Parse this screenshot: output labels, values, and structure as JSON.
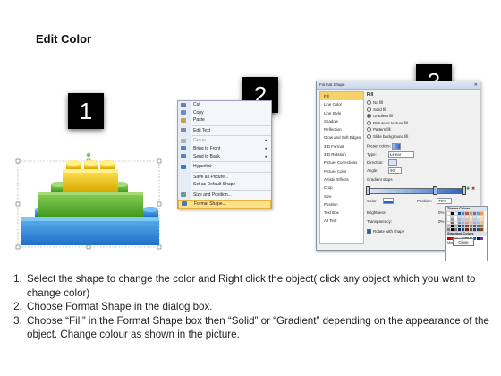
{
  "title": "Edit Color",
  "steps": {
    "one": "1",
    "two": "2",
    "three": "3"
  },
  "context_menu": {
    "items": [
      {
        "label": "Cut",
        "icon": "scissors-icon",
        "state": "normal",
        "color": "#6a7fa0"
      },
      {
        "label": "Copy",
        "icon": "copy-icon",
        "state": "normal",
        "color": "#6a8cc0"
      },
      {
        "label": "Paste",
        "icon": "paste-icon",
        "state": "normal",
        "color": "#c8a24a"
      },
      {
        "label": "Edit Text",
        "icon": "edit-text-icon",
        "state": "normal",
        "color": "#7d8aa0"
      },
      {
        "label": "Group",
        "icon": "group-icon",
        "state": "disabled",
        "color": "#b0b0b0",
        "submenu": true
      },
      {
        "label": "Bring to Front",
        "icon": "bring-front-icon",
        "state": "normal",
        "color": "#5d7fb6",
        "submenu": true
      },
      {
        "label": "Send to Back",
        "icon": "send-back-icon",
        "state": "normal",
        "color": "#5d7fb6",
        "submenu": true
      },
      {
        "label": "Hyperlink...",
        "icon": "hyperlink-icon",
        "state": "normal",
        "color": "#3c78c8"
      },
      {
        "label": "Save as Picture...",
        "icon": "",
        "state": "normal",
        "color": ""
      },
      {
        "label": "Set as Default Shape",
        "icon": "",
        "state": "normal",
        "color": ""
      },
      {
        "label": "Size and Position...",
        "icon": "size-position-icon",
        "state": "normal",
        "color": "#7890b0"
      },
      {
        "label": "Format Shape...",
        "icon": "format-shape-icon",
        "state": "highlighted",
        "color": "#4a78c0"
      }
    ]
  },
  "dialog": {
    "title": "Format Shape",
    "sidebar": [
      "Fill",
      "Line Color",
      "Line Style",
      "Shadow",
      "Reflection",
      "Glow and Soft Edges",
      "3-D Format",
      "3-D Rotation",
      "Picture Corrections",
      "Picture Color",
      "Artistic Effects",
      "Crop",
      "Size",
      "Position",
      "Text Box",
      "Alt Text"
    ],
    "selected_index": 0,
    "fill": {
      "heading": "Fill",
      "options": [
        "No fill",
        "Solid fill",
        "Gradient fill",
        "Picture or texture fill",
        "Pattern fill",
        "Slide background fill"
      ],
      "selected_option": 2,
      "preset_label": "Preset colors:",
      "type_label": "Type:",
      "type_value": "Linear",
      "direction_label": "Direction:",
      "angle_label": "Angle:",
      "angle_value": "90°",
      "stops_label": "Gradient stops",
      "color_label": "Color",
      "position_label": "Position:",
      "position_value": "70%",
      "brightness_label": "Brightness:",
      "brightness_value": "0%",
      "transparency_label": "Transparency:",
      "transparency_value": "0%",
      "rotate_label": "Rotate with shape",
      "close_label": "Close"
    },
    "palette": {
      "theme_label": "Theme Colors",
      "standard_label": "Standard Colors",
      "more_label": "More Colors...",
      "theme_columns": [
        "#ffffff",
        "#000000",
        "#eeece1",
        "#1f497d",
        "#4f81bd",
        "#c0504d",
        "#9bbb59",
        "#8064a2",
        "#4bacc6",
        "#f79646"
      ],
      "standard": [
        "#c00000",
        "#ff0000",
        "#ffc000",
        "#ffff00",
        "#92d050",
        "#00b050",
        "#00b0f0",
        "#0070c0",
        "#002060",
        "#7030a0"
      ]
    }
  },
  "instructions": [
    "Select the shape to change the color and Right click the object( click any object which you want to change color)",
    "Choose Format Shape in the dialog box.",
    "Choose “Fill” in the Format Shape box then “Solid” or “Gradient” depending on the appearance of the object. Change colour as shown in the picture."
  ]
}
